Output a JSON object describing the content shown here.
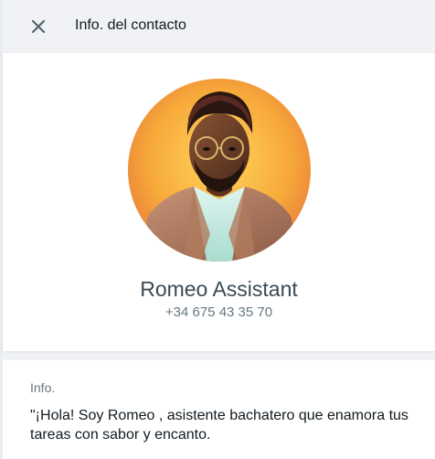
{
  "header": {
    "title": "Info. del contacto",
    "close_icon": "close-icon"
  },
  "contact": {
    "name": "Romeo Assistant",
    "phone": "+34 675 43 35 70"
  },
  "info": {
    "label": "Info.",
    "text": "\"¡Hola! Soy Romeo , asistente bachatero que enamora tus tareas con sabor y encanto."
  },
  "colors": {
    "background": "#f0f2f5",
    "panel": "#ffffff",
    "primary_text": "#111b21",
    "secondary_text": "#667781",
    "name_text": "#3b4a54"
  }
}
